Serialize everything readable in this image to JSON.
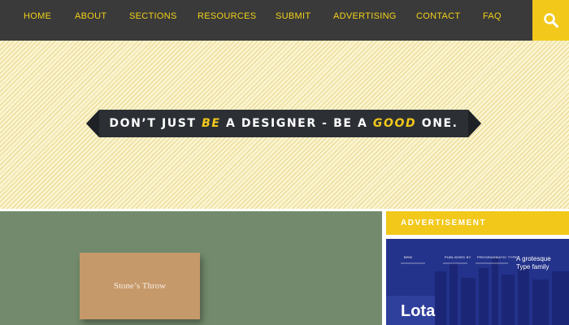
{
  "nav": {
    "items": [
      "HOME",
      "ABOUT",
      "SECTIONS",
      "RESOURCES",
      "SUBMIT",
      "ADVERTISING",
      "CONTACT",
      "FAQ"
    ]
  },
  "search": {
    "icon": "search-icon"
  },
  "hero": {
    "banner_parts": [
      "DON’T JUST ",
      "BE",
      " A DESIGNER - BE A ",
      "GOOD",
      " ONE."
    ]
  },
  "feature": {
    "card_text": "Stone’s Throw"
  },
  "sidebar": {
    "ad_heading": "ADVERTISEMENT",
    "ad": {
      "tagline_line1": "A grotesque",
      "tagline_line2": "Type family",
      "brand": "Lota",
      "small_labels": [
        "BRW",
        "PUBLISHED BY",
        "PROGRAMMATIC TYPE"
      ]
    }
  },
  "colors": {
    "nav_bg": "#3a3a3a",
    "accent": "#f2c81a",
    "hero_bg": "#fbf4cf",
    "feature_bg": "#738b6c",
    "ad_bg": "#23328a"
  }
}
